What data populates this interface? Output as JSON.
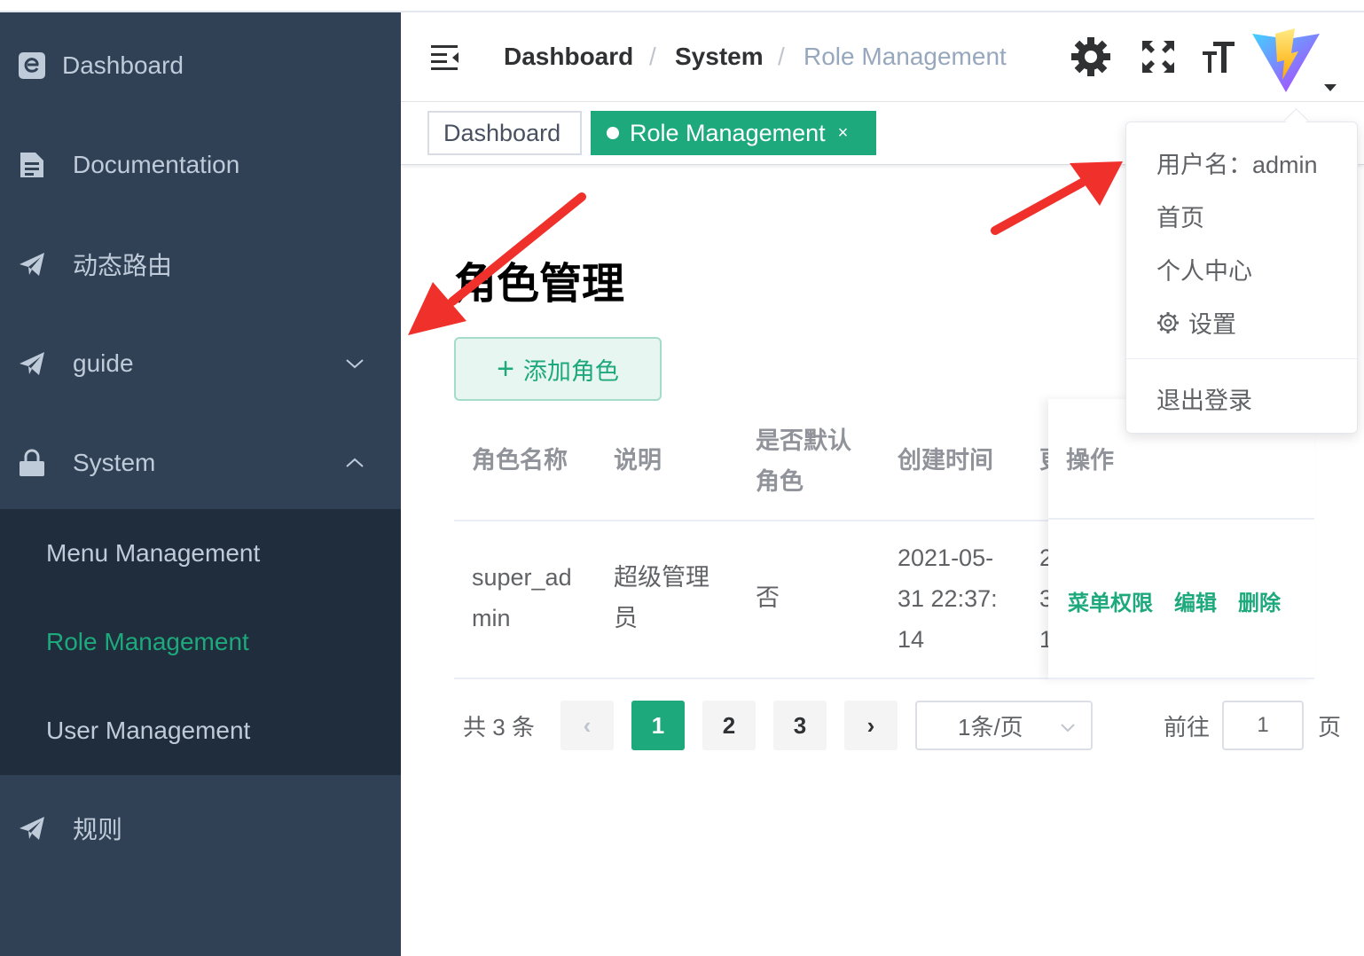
{
  "sidebar": {
    "items": [
      {
        "label": "Dashboard",
        "icon": "dashboard-logo-icon"
      },
      {
        "label": "Documentation",
        "icon": "document-icon"
      },
      {
        "label": "动态路由",
        "icon": "paper-plane-icon"
      },
      {
        "label": "guide",
        "icon": "paper-plane-icon",
        "expandable": true
      },
      {
        "label": "System",
        "icon": "lock-icon",
        "expanded": true
      },
      {
        "label": "规则",
        "icon": "paper-plane-icon"
      }
    ],
    "submenu": [
      {
        "label": "Menu Management"
      },
      {
        "label": "Role Management",
        "active": true
      },
      {
        "label": "User Management"
      }
    ]
  },
  "header": {
    "breadcrumb": [
      "Dashboard",
      "System",
      "Role Management"
    ],
    "separator": "/",
    "icons": [
      "settings-icon",
      "fullscreen-icon",
      "font-size-icon",
      "avatar-vite-logo"
    ]
  },
  "tags": [
    {
      "label": "Dashboard"
    },
    {
      "label": "Role Management",
      "active": true,
      "close": "×"
    }
  ],
  "page": {
    "title": "角色管理",
    "add_button": "添加角色",
    "add_button_icon": "+"
  },
  "table": {
    "headers": [
      "角色名称",
      "说明",
      "是否默认角色",
      "创建时间",
      "更",
      "操作"
    ],
    "header_default_line1": "是否默认",
    "header_default_line2": "角色",
    "row": {
      "name_line1": "super_ad",
      "name_line2": "min",
      "desc_line1": "超级管理",
      "desc_line2": "员",
      "default": "否",
      "created_line1": "2021-05-",
      "created_line2": "31 22:37:",
      "created_line3": "14",
      "updated_line1": "2",
      "updated_line2": "3",
      "updated_line3": "1",
      "actions": [
        "菜单权限",
        "编辑",
        "删除"
      ]
    }
  },
  "pagination": {
    "total": "共 3 条",
    "pages": [
      "1",
      "2",
      "3"
    ],
    "current": "1",
    "prev": "‹",
    "next": "›",
    "page_size": "1条/页",
    "goto_label": "前往",
    "goto_value": "1",
    "goto_suffix": "页"
  },
  "dropdown": {
    "username": "用户名：admin",
    "items": [
      "首页",
      "个人中心",
      "设置"
    ],
    "logout": "退出登录"
  },
  "colors": {
    "sidebar_bg": "#304156",
    "submenu_bg": "#1f2d3d",
    "accent": "#1ea97c",
    "annotation_arrow": "#f0302a"
  }
}
